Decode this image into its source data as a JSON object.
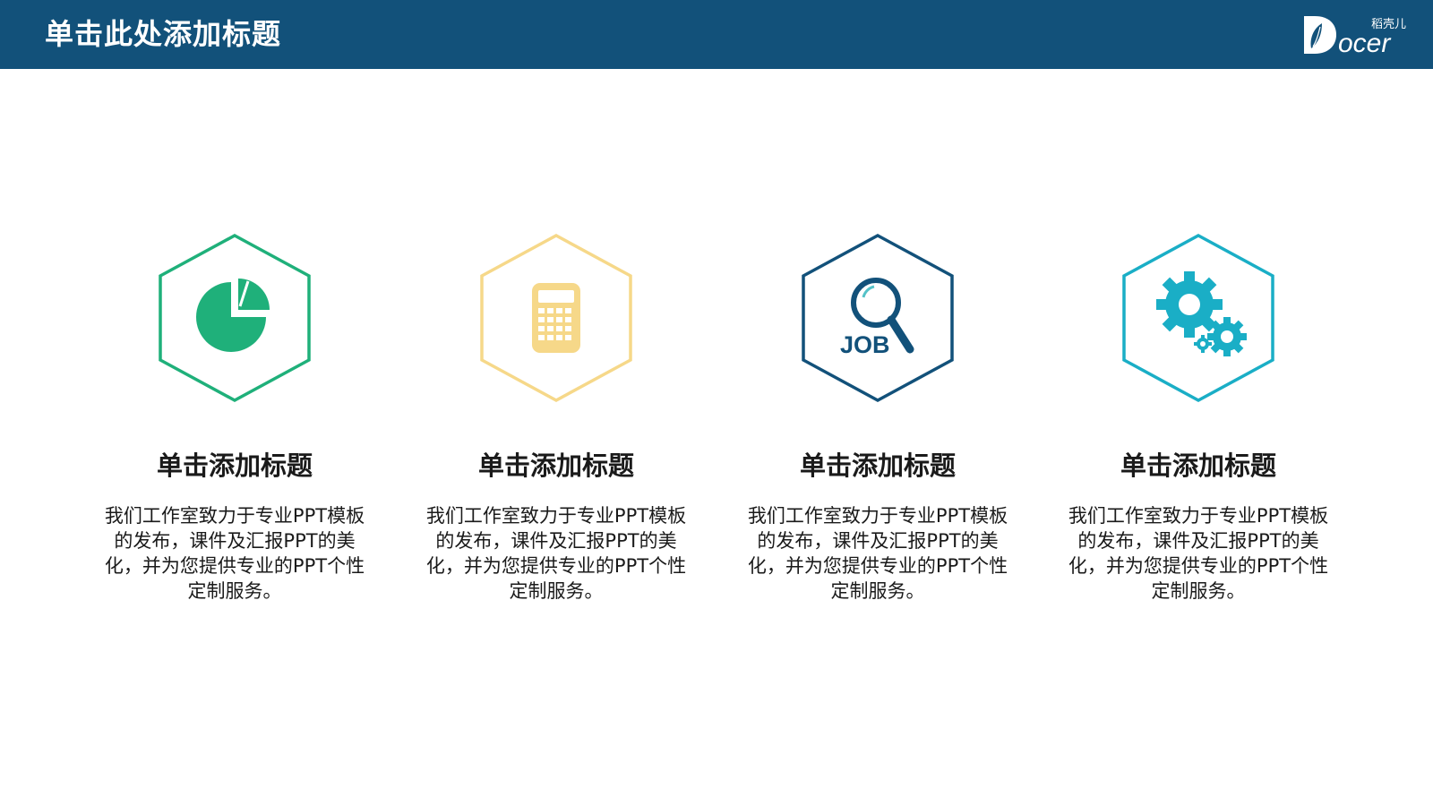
{
  "header": {
    "title": "单击此处添加标题",
    "logo_text": "Docer",
    "logo_small": "稻壳儿",
    "bg_color": "#12517a"
  },
  "cards": [
    {
      "title": "单击添加标题",
      "description": "我们工作室致力于专业PPT模板的发布，课件及汇报PPT的美化，并为您提供专业的PPT个性定制服务。",
      "icon": "pie-chart-icon",
      "color": "#1fb07a"
    },
    {
      "title": "单击添加标题",
      "description": "我们工作室致力于专业PPT模板的发布，课件及汇报PPT的美化，并为您提供专业的PPT个性定制服务。",
      "icon": "calculator-icon",
      "color": "#f6d889"
    },
    {
      "title": "单击添加标题",
      "description": "我们工作室致力于专业PPT模板的发布，课件及汇报PPT的美化，并为您提供专业的PPT个性定制服务。",
      "icon": "job-search-icon",
      "icon_label": "JOB",
      "color": "#12517a"
    },
    {
      "title": "单击添加标题",
      "description": "我们工作室致力于专业PPT模板的发布，课件及汇报PPT的美化，并为您提供专业的PPT个性定制服务。",
      "icon": "gears-icon",
      "color": "#1aaec6"
    }
  ]
}
